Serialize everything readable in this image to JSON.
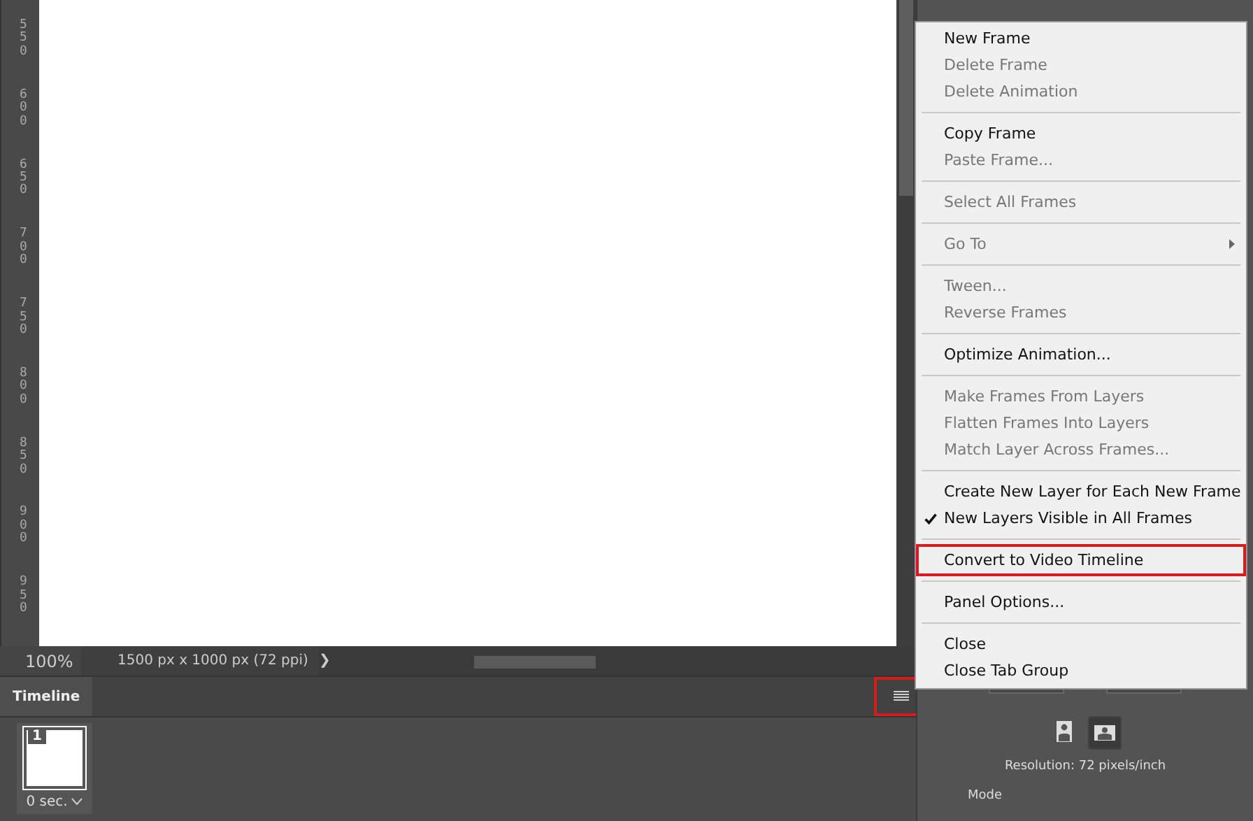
{
  "ruler": {
    "labels": [
      "550",
      "600",
      "650",
      "700",
      "750",
      "800",
      "850",
      "900",
      "950"
    ]
  },
  "status_bar": {
    "zoom": "100%",
    "doc_info": "1500 px x 1000 px (72 ppi)",
    "arrow": "❯"
  },
  "timeline": {
    "tab": {
      "label": "Timeline",
      "selected": true
    },
    "menu_button": {
      "highlighted": true
    },
    "frames": [
      {
        "number": "1",
        "duration": "0 sec.",
        "selected": true
      }
    ]
  },
  "properties": {
    "orientations": [
      {
        "kind": "portrait",
        "selected": false
      },
      {
        "kind": "landscape",
        "selected": true
      }
    ],
    "resolution": "Resolution: 72 pixels/inch",
    "mode": "Mode"
  },
  "menu": {
    "groups": [
      {
        "items": [
          {
            "label": "New Frame",
            "disabled": false
          },
          {
            "label": "Delete Frame",
            "disabled": true
          },
          {
            "label": "Delete Animation",
            "disabled": true
          }
        ]
      },
      {
        "items": [
          {
            "label": "Copy Frame",
            "disabled": false
          },
          {
            "label": "Paste Frame...",
            "disabled": true
          }
        ]
      },
      {
        "items": [
          {
            "label": "Select All Frames",
            "disabled": true
          }
        ]
      },
      {
        "items": [
          {
            "label": "Go To",
            "disabled": true,
            "submenu": true
          }
        ]
      },
      {
        "items": [
          {
            "label": "Tween...",
            "disabled": true
          },
          {
            "label": "Reverse Frames",
            "disabled": true
          }
        ]
      },
      {
        "items": [
          {
            "label": "Optimize Animation...",
            "disabled": false
          }
        ]
      },
      {
        "items": [
          {
            "label": "Make Frames From Layers",
            "disabled": true
          },
          {
            "label": "Flatten Frames Into Layers",
            "disabled": true
          },
          {
            "label": "Match Layer Across Frames...",
            "disabled": true
          }
        ]
      },
      {
        "items": [
          {
            "label": "Create New Layer for Each New Frame",
            "disabled": false,
            "checked": false
          },
          {
            "label": "New Layers Visible in All Frames",
            "disabled": false,
            "checked": true
          }
        ]
      },
      {
        "items": [
          {
            "label": "Convert to Video Timeline",
            "disabled": false,
            "highlighted": true
          }
        ]
      },
      {
        "items": [
          {
            "label": "Panel Options...",
            "disabled": false
          }
        ]
      },
      {
        "items": [
          {
            "label": "Close",
            "disabled": false
          },
          {
            "label": "Close Tab Group",
            "disabled": false
          }
        ]
      }
    ]
  }
}
